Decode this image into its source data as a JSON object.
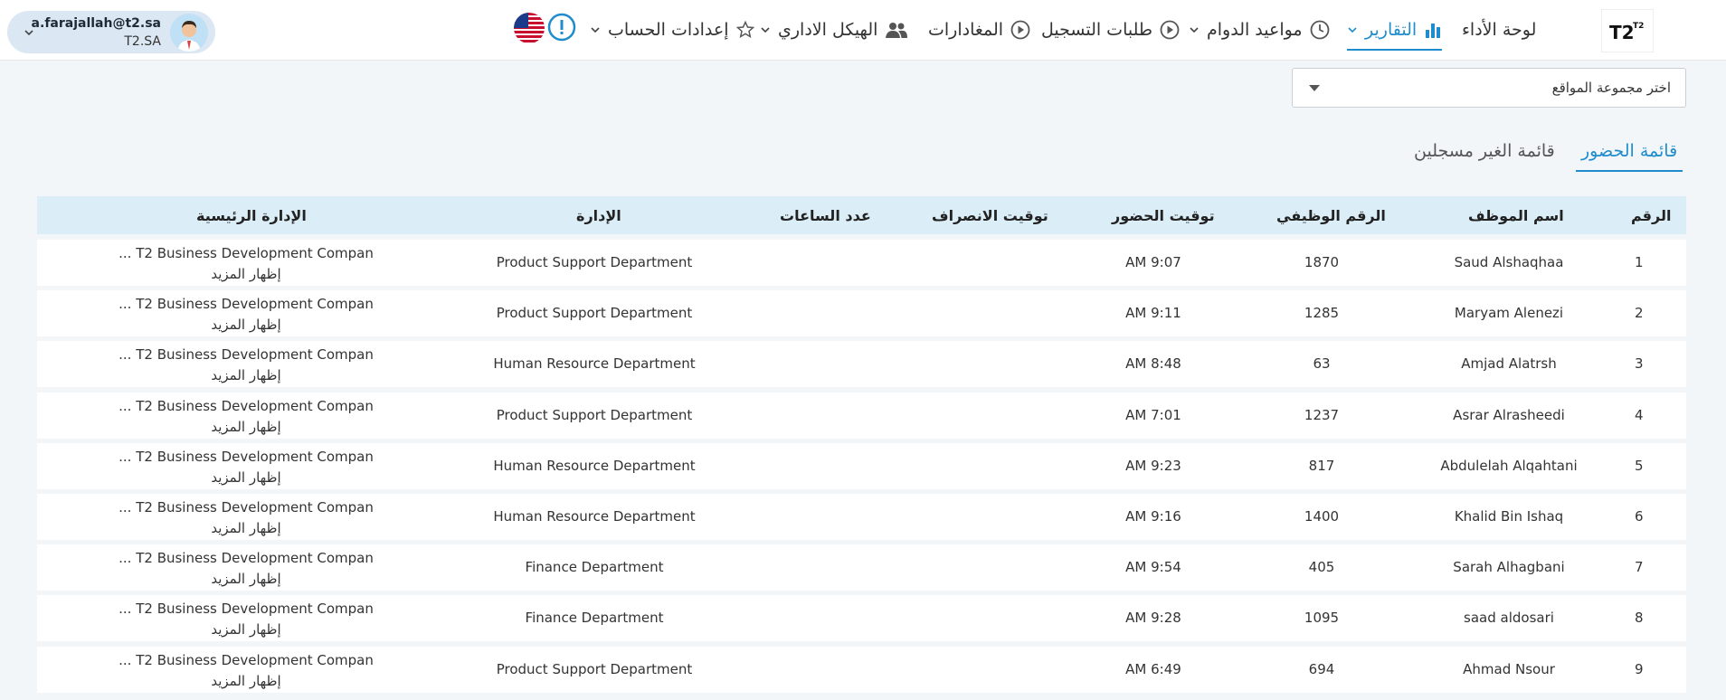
{
  "header": {
    "user": {
      "email": "a.farajallah@t2.sa",
      "org": "T2.SA"
    },
    "logo_text": "T2",
    "nav": [
      {
        "id": "dashboard",
        "label": "لوحة الأداء",
        "icon": "",
        "has_dropdown": false,
        "active": false
      },
      {
        "id": "reports",
        "label": "التقارير",
        "icon": "bar-chart-icon",
        "has_dropdown": true,
        "active": true
      },
      {
        "id": "schedules",
        "label": "مواعيد الدوام",
        "icon": "clock-icon",
        "has_dropdown": true,
        "active": false
      },
      {
        "id": "requests",
        "label": "طلبات التسجيل",
        "icon": "play-circle-icon",
        "has_dropdown": false,
        "active": false
      },
      {
        "id": "departures",
        "label": "المغادارات",
        "icon": "play-circle-icon",
        "has_dropdown": false,
        "active": false
      },
      {
        "id": "org",
        "label": "الهيكل الاداري",
        "icon": "people-icon",
        "has_dropdown": true,
        "active": false
      },
      {
        "id": "settings",
        "label": "إعدادات الحساب",
        "icon": "star-icon",
        "has_dropdown": true,
        "active": false
      }
    ]
  },
  "site_select": {
    "placeholder": "اختر مجموعة المواقع"
  },
  "tabs": {
    "attendance": "قائمة الحضور",
    "unregistered": "قائمة الغير مسجلين"
  },
  "columns": {
    "num": "الرقم",
    "name": "اسم الموظف",
    "emp_id": "الرقم الوظيفي",
    "check_in": "توقيت الحضور",
    "check_out": "توقيت الانصراف",
    "hours": "عدد الساعات",
    "dept": "الإدارة",
    "main_dept": "الإدارة الرئيسية"
  },
  "rows": [
    {
      "num": "1",
      "name": "Saud Alshaqhaa",
      "emp_id": "1870",
      "check_in": "AM 9:07",
      "check_out": "",
      "hours": "",
      "dept": "Product Support Department",
      "main_dept": "... T2 Business Development Compan",
      "more": "إظهار المزيد"
    },
    {
      "num": "2",
      "name": "Maryam Alenezi",
      "emp_id": "1285",
      "check_in": "AM 9:11",
      "check_out": "",
      "hours": "",
      "dept": "Product Support Department",
      "main_dept": "... T2 Business Development Compan",
      "more": "إظهار المزيد"
    },
    {
      "num": "3",
      "name": "Amjad Alatrsh",
      "emp_id": "63",
      "check_in": "AM 8:48",
      "check_out": "",
      "hours": "",
      "dept": "Human Resource Department",
      "main_dept": "... T2 Business Development Compan",
      "more": "إظهار المزيد"
    },
    {
      "num": "4",
      "name": "Asrar Alrasheedi",
      "emp_id": "1237",
      "check_in": "AM 7:01",
      "check_out": "",
      "hours": "",
      "dept": "Product Support Department",
      "main_dept": "... T2 Business Development Compan",
      "more": "إظهار المزيد"
    },
    {
      "num": "5",
      "name": "Abdulelah Alqahtani",
      "emp_id": "817",
      "check_in": "AM 9:23",
      "check_out": "",
      "hours": "",
      "dept": "Human Resource Department",
      "main_dept": "... T2 Business Development Compan",
      "more": "إظهار المزيد"
    },
    {
      "num": "6",
      "name": "Khalid Bin Ishaq",
      "emp_id": "1400",
      "check_in": "AM 9:16",
      "check_out": "",
      "hours": "",
      "dept": "Human Resource Department",
      "main_dept": "... T2 Business Development Compan",
      "more": "إظهار المزيد"
    },
    {
      "num": "7",
      "name": "Sarah Alhagbani",
      "emp_id": "405",
      "check_in": "AM 9:54",
      "check_out": "",
      "hours": "",
      "dept": "Finance Department",
      "main_dept": "... T2 Business Development Compan",
      "more": "إظهار المزيد"
    },
    {
      "num": "8",
      "name": "saad aldosari",
      "emp_id": "1095",
      "check_in": "AM 9:28",
      "check_out": "",
      "hours": "",
      "dept": "Finance Department",
      "main_dept": "... T2 Business Development Compan",
      "more": "إظهار المزيد"
    },
    {
      "num": "9",
      "name": "Ahmad Nsour",
      "emp_id": "694",
      "check_in": "AM 6:49",
      "check_out": "",
      "hours": "",
      "dept": "Product Support Department",
      "main_dept": "... T2 Business Development Compan",
      "more": "إظهار المزيد"
    }
  ],
  "colors": {
    "accent": "#1e8ccd",
    "header_row": "#dbeef8",
    "page_bg": "#f3f6f9"
  }
}
